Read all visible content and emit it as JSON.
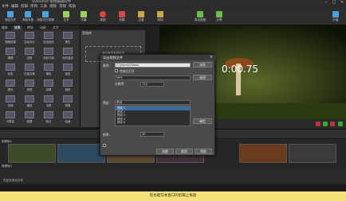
{
  "titlebar": {
    "title": "VideoPad 视频编辑软件"
  },
  "menus": [
    "文件",
    "编辑",
    "剪辑",
    "序列",
    "工具",
    "视频",
    "音频",
    "帮助"
  ],
  "toolbar": [
    "添加文件",
    "添加对象",
    "添加空白剪辑",
    "文本",
    "字幕",
    "录制",
    "效果",
    "过渡",
    "转场",
    "导出视频",
    "分享",
    "升级"
  ],
  "left_tabs": [
    "媒体",
    "效果",
    "转场",
    "动画",
    "文字"
  ],
  "effects": [
    "视频效果",
    "自动对比",
    "自动色阶",
    "黑白",
    "模糊",
    "边框",
    "色彩平衡",
    "色彩曲线",
    "彩色",
    "红蓝互换",
    "褪色",
    "延迟",
    "调光",
    "滤镜",
    "浮雕",
    "旋转",
    "拉伸",
    "缩放",
    "平移",
    "镜像",
    "马赛克",
    "遮罩",
    "噪点",
    "绘画"
  ],
  "library": {
    "header": "音效库",
    "hint": "添加音效到项目中"
  },
  "preview": {
    "timecode": "0:00.75"
  },
  "timeline": {
    "track_labels": [
      "视频轨1",
      "音频轨1"
    ],
    "text_row": "在此处添加文本"
  },
  "hint": "您也能在本窗口的剪辑上拖放"
}
